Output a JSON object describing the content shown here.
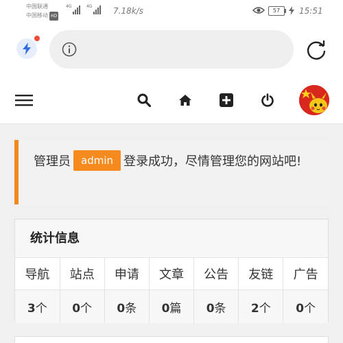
{
  "status_bar": {
    "carrier_1": "中国联通",
    "carrier_2": "中国移动",
    "hd_badge": "HD",
    "signal_label_1": "4G",
    "signal_label_2": "4G",
    "net_speed": "7.18k/s",
    "battery": "57",
    "time": "15:51"
  },
  "browser": {
    "bolt_icon": "lightning-icon",
    "info_icon": "info-icon",
    "refresh_icon": "refresh-icon",
    "address_text": ""
  },
  "nav": {
    "icons": [
      "menu-icon",
      "search-icon",
      "home-icon",
      "add-icon",
      "power-icon"
    ]
  },
  "alert": {
    "prefix": "管理员",
    "username": "admin",
    "message": "登录成功，尽情管理您的网站吧!",
    "accent_color": "#f0891f"
  },
  "stats": {
    "title": "统计信息",
    "labels": [
      "导航",
      "站点",
      "申请",
      "文章",
      "公告",
      "友链",
      "广告"
    ],
    "values": [
      {
        "num": "3",
        "unit": "个"
      },
      {
        "num": "0",
        "unit": "个"
      },
      {
        "num": "0",
        "unit": "条"
      },
      {
        "num": "0",
        "unit": "篇"
      },
      {
        "num": "0",
        "unit": "条"
      },
      {
        "num": "2",
        "unit": "个"
      },
      {
        "num": "0",
        "unit": "个"
      }
    ]
  }
}
